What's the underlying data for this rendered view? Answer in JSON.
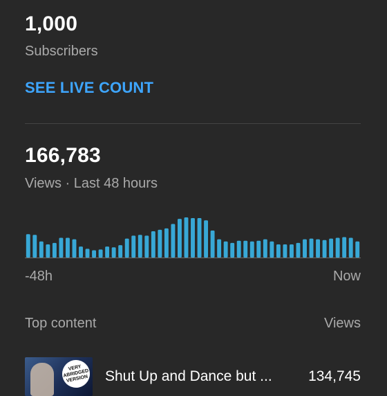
{
  "subscribers": {
    "count": "1,000",
    "label": "Subscribers",
    "live_link": "SEE LIVE COUNT"
  },
  "views": {
    "count": "166,783",
    "label": "Views · Last 48 hours"
  },
  "chart_data": {
    "type": "bar",
    "x_start_label": "-48h",
    "x_end_label": "Now",
    "color": "#38a8d6",
    "values": [
      32,
      31,
      22,
      18,
      20,
      27,
      27,
      25,
      15,
      12,
      10,
      11,
      15,
      14,
      17,
      26,
      30,
      31,
      30,
      36,
      38,
      40,
      46,
      53,
      55,
      54,
      54,
      51,
      37,
      25,
      22,
      20,
      23,
      23,
      22,
      23,
      25,
      22,
      18,
      18,
      18,
      20,
      25,
      26,
      25,
      24,
      26,
      27,
      28,
      27,
      22
    ]
  },
  "top_content": {
    "heading": "Top content",
    "views_heading": "Views",
    "items": [
      {
        "title": "Shut Up and Dance but ...",
        "views": "134,745",
        "thumbnail_text": "VERY ABRIDGED VERSION"
      }
    ]
  }
}
